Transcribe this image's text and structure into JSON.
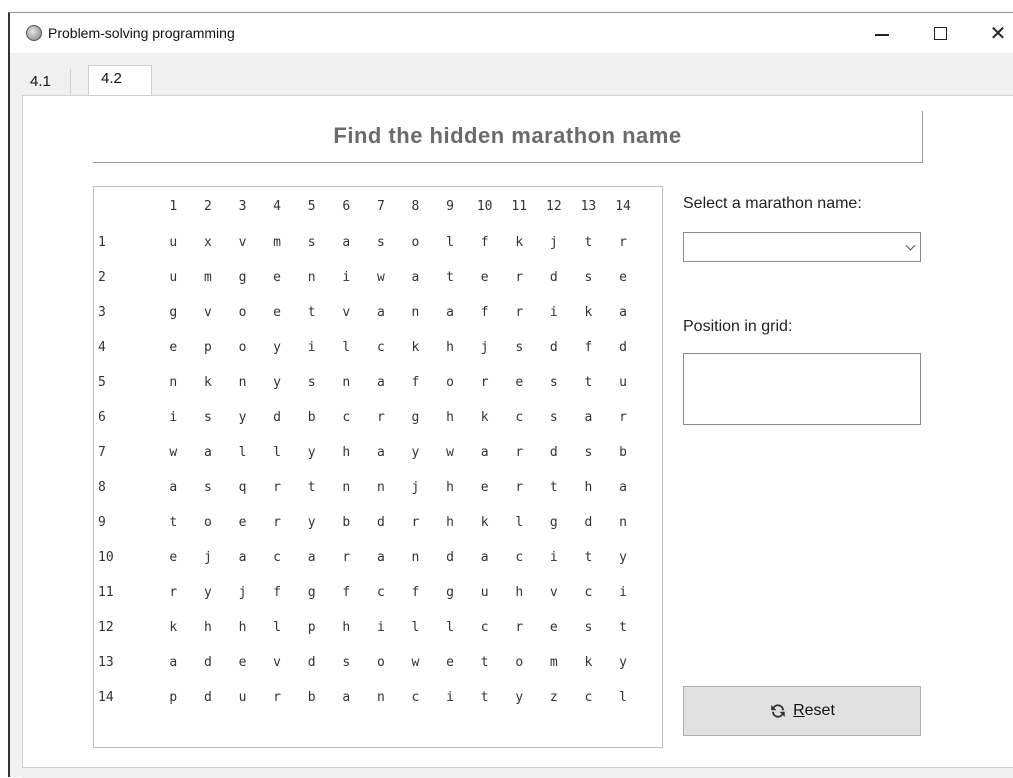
{
  "window": {
    "title": "Problem-solving programming",
    "controls": {
      "minimize": "minimize",
      "maximize": "maximize",
      "close": "close"
    }
  },
  "tabs": [
    {
      "label": "4.1",
      "selected": false
    },
    {
      "label": "4.2",
      "selected": true
    }
  ],
  "heading": "Find the hidden marathon name",
  "grid": {
    "columns": [
      "1",
      "2",
      "3",
      "4",
      "5",
      "6",
      "7",
      "8",
      "9",
      "10",
      "11",
      "12",
      "13",
      "14"
    ],
    "rows": [
      {
        "label": "1",
        "letters": [
          "u",
          "x",
          "v",
          "m",
          "s",
          "a",
          "s",
          "o",
          "l",
          "f",
          "k",
          "j",
          "t",
          "r"
        ]
      },
      {
        "label": "2",
        "letters": [
          "u",
          "m",
          "g",
          "e",
          "n",
          "i",
          "w",
          "a",
          "t",
          "e",
          "r",
          "d",
          "s",
          "e"
        ]
      },
      {
        "label": "3",
        "letters": [
          "g",
          "v",
          "o",
          "e",
          "t",
          "v",
          "a",
          "n",
          "a",
          "f",
          "r",
          "i",
          "k",
          "a"
        ]
      },
      {
        "label": "4",
        "letters": [
          "e",
          "p",
          "o",
          "y",
          "i",
          "l",
          "c",
          "k",
          "h",
          "j",
          "s",
          "d",
          "f",
          "d"
        ]
      },
      {
        "label": "5",
        "letters": [
          "n",
          "k",
          "n",
          "y",
          "s",
          "n",
          "a",
          "f",
          "o",
          "r",
          "e",
          "s",
          "t",
          "u"
        ]
      },
      {
        "label": "6",
        "letters": [
          "i",
          "s",
          "y",
          "d",
          "b",
          "c",
          "r",
          "g",
          "h",
          "k",
          "c",
          "s",
          "a",
          "r"
        ]
      },
      {
        "label": "7",
        "letters": [
          "w",
          "a",
          "l",
          "l",
          "y",
          "h",
          "a",
          "y",
          "w",
          "a",
          "r",
          "d",
          "s",
          "b"
        ]
      },
      {
        "label": "8",
        "letters": [
          "a",
          "s",
          "q",
          "r",
          "t",
          "n",
          "n",
          "j",
          "h",
          "e",
          "r",
          "t",
          "h",
          "a"
        ]
      },
      {
        "label": "9",
        "letters": [
          "t",
          "o",
          "e",
          "r",
          "y",
          "b",
          "d",
          "r",
          "h",
          "k",
          "l",
          "g",
          "d",
          "n"
        ]
      },
      {
        "label": "10",
        "letters": [
          "e",
          "j",
          "a",
          "c",
          "a",
          "r",
          "a",
          "n",
          "d",
          "a",
          "c",
          "i",
          "t",
          "y"
        ]
      },
      {
        "label": "11",
        "letters": [
          "r",
          "y",
          "j",
          "f",
          "g",
          "f",
          "c",
          "f",
          "g",
          "u",
          "h",
          "v",
          "c",
          "i"
        ]
      },
      {
        "label": "12",
        "letters": [
          "k",
          "h",
          "h",
          "l",
          "p",
          "h",
          "i",
          "l",
          "l",
          "c",
          "r",
          "e",
          "s",
          "t"
        ]
      },
      {
        "label": "13",
        "letters": [
          "a",
          "d",
          "e",
          "v",
          "d",
          "s",
          "o",
          "w",
          "e",
          "t",
          "o",
          "m",
          "k",
          "y"
        ]
      },
      {
        "label": "14",
        "letters": [
          "p",
          "d",
          "u",
          "r",
          "b",
          "a",
          "n",
          "c",
          "i",
          "t",
          "y",
          "z",
          "c",
          "l"
        ]
      }
    ]
  },
  "select_marathon": {
    "label": "Select a marathon name:",
    "value": ""
  },
  "position": {
    "label": "Position in grid:",
    "value": ""
  },
  "reset_button": {
    "label_first": "R",
    "label_rest": "eset",
    "icon": "refresh-icon"
  }
}
